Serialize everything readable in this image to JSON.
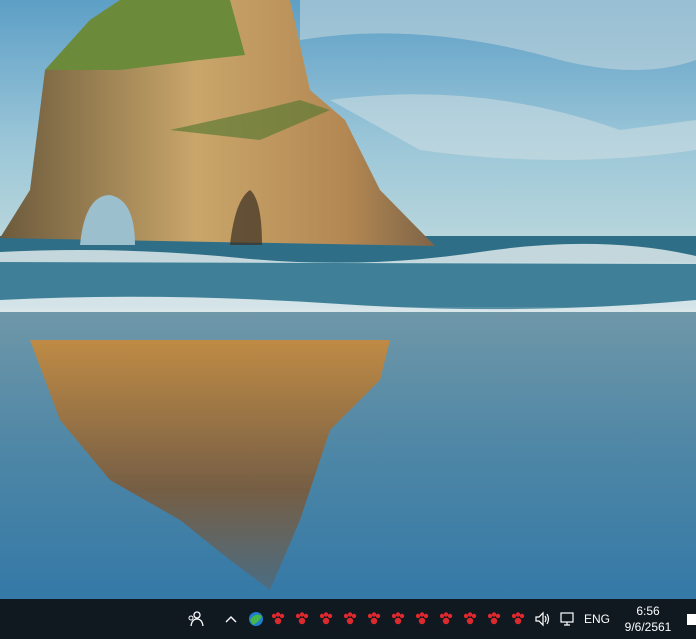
{
  "desktop": {
    "wallpaper": "beach-rock-arch-wallpaper"
  },
  "taskbar": {
    "background": "#101820",
    "people_icon": "people-icon",
    "tray_overflow_icon": "chevron-up-icon",
    "tray_apps": [
      "globe-tray-icon",
      "paw-tray-icon",
      "paw-tray-icon",
      "paw-tray-icon",
      "paw-tray-icon",
      "paw-tray-icon",
      "paw-tray-icon",
      "paw-tray-icon",
      "paw-tray-icon",
      "paw-tray-icon",
      "paw-tray-icon",
      "paw-tray-icon"
    ],
    "tray_icon_color": "#e0292e",
    "volume_icon": "speaker-icon",
    "network_icon": "network-icon",
    "language": "ENG",
    "time": "6:56",
    "date": "9/6/2561",
    "notification_icon": "notification-icon"
  }
}
